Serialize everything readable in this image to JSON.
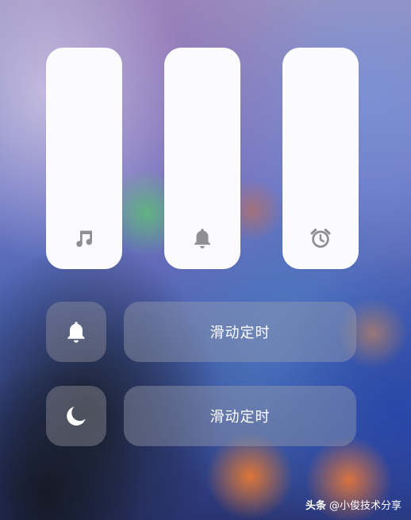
{
  "volume_sliders": [
    {
      "name": "media",
      "icon": "music-note-icon"
    },
    {
      "name": "ringtone",
      "icon": "bell-icon"
    },
    {
      "name": "alarm",
      "icon": "alarm-clock-icon"
    }
  ],
  "controls": {
    "row1": {
      "toggle_icon": "bell-icon",
      "timer_label": "滑动定时"
    },
    "row2": {
      "toggle_icon": "moon-icon",
      "timer_label": "滑动定时"
    }
  },
  "watermark": {
    "brand": "头条",
    "account": "@小俊技术分享"
  },
  "colors": {
    "slider_fill": "#fbfbfd",
    "slider_icon": "#8e8e93",
    "tile_icon": "#ffffff",
    "text": "#ffffff"
  }
}
